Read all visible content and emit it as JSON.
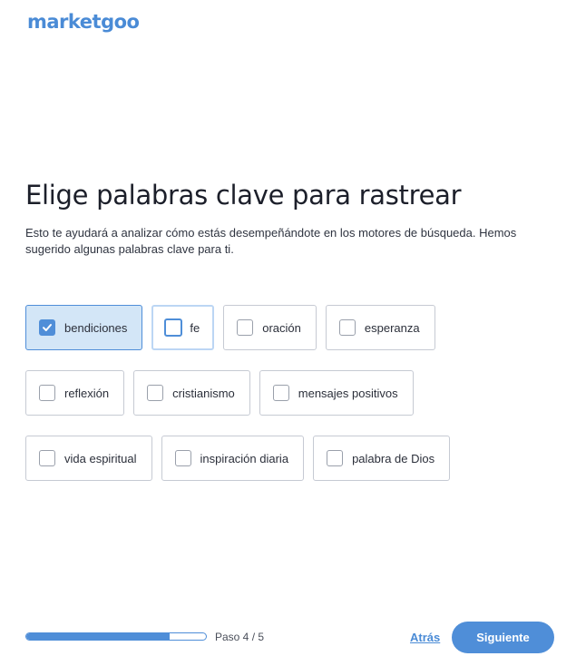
{
  "brand": {
    "logo_text": "marketgoo"
  },
  "header": {
    "title": "Elige palabras clave para rastrear",
    "subtitle": "Esto te ayudará a analizar cómo estás desempeñándote en los motores de búsqueda. Hemos sugerido algunas palabras clave para ti."
  },
  "keywords": [
    {
      "label": "bendiciones",
      "checked": true
    },
    {
      "label": "fe",
      "checked": false,
      "focused": true
    },
    {
      "label": "oración",
      "checked": false
    },
    {
      "label": "esperanza",
      "checked": false
    },
    {
      "label": "reflexión",
      "checked": false
    },
    {
      "label": "cristianismo",
      "checked": false
    },
    {
      "label": "mensajes positivos",
      "checked": false
    },
    {
      "label": "vida espiritual",
      "checked": false
    },
    {
      "label": "inspiración diaria",
      "checked": false
    },
    {
      "label": "palabra de Dios",
      "checked": false
    }
  ],
  "footer": {
    "progress_fraction": 0.8,
    "step_text": "Paso 4 / 5",
    "back_label": "Atrás",
    "next_label": "Siguiente"
  },
  "colors": {
    "accent": "#4f8ed8",
    "logo": "#4a8bd6",
    "checked_bg": "#d3e6f7",
    "focus_ring": "#bcd6f4"
  },
  "icons": {
    "checkbox_checked": "check-icon"
  }
}
